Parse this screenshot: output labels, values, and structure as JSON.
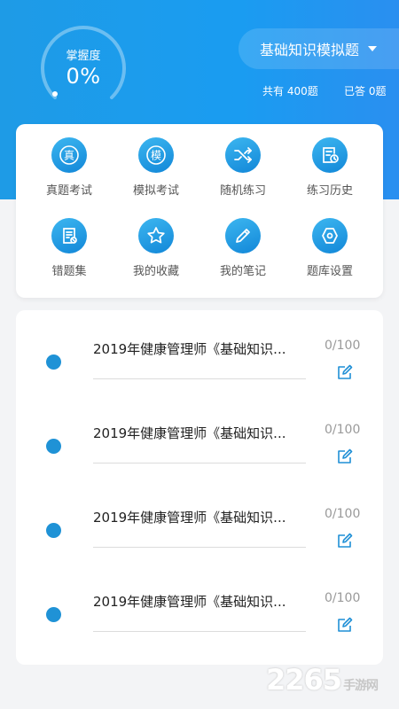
{
  "header": {
    "mastery_label": "掌握度",
    "mastery_value": "0%",
    "mastery_fraction": 0,
    "bank_title": "基础知识模拟题",
    "total_label": "共有 400题",
    "answered_label": "已答 0题"
  },
  "tools": [
    {
      "label": "真题考试",
      "glyph": "真",
      "icon": "real-exam-icon"
    },
    {
      "label": "模拟考试",
      "glyph": "模",
      "icon": "mock-exam-icon"
    },
    {
      "label": "随机练习",
      "glyph": "",
      "icon": "shuffle-icon"
    },
    {
      "label": "练习历史",
      "glyph": "",
      "icon": "history-icon"
    },
    {
      "label": "错题集",
      "glyph": "",
      "icon": "wrong-questions-icon"
    },
    {
      "label": "我的收藏",
      "glyph": "",
      "icon": "star-icon"
    },
    {
      "label": "我的笔记",
      "glyph": "",
      "icon": "pencil-icon"
    },
    {
      "label": "题库设置",
      "glyph": "",
      "icon": "settings-icon"
    }
  ],
  "papers": [
    {
      "title": "2019年健康管理师《基础知识...",
      "progress": "0/100"
    },
    {
      "title": "2019年健康管理师《基础知识...",
      "progress": "0/100"
    },
    {
      "title": "2019年健康管理师《基础知识...",
      "progress": "0/100"
    },
    {
      "title": "2019年健康管理师《基础知识...",
      "progress": "0/100"
    }
  ],
  "watermark": {
    "brand": "2265",
    "suffix": "手游网"
  },
  "colors": {
    "primary": "#1a9cf1",
    "accent": "#1f92d6"
  }
}
